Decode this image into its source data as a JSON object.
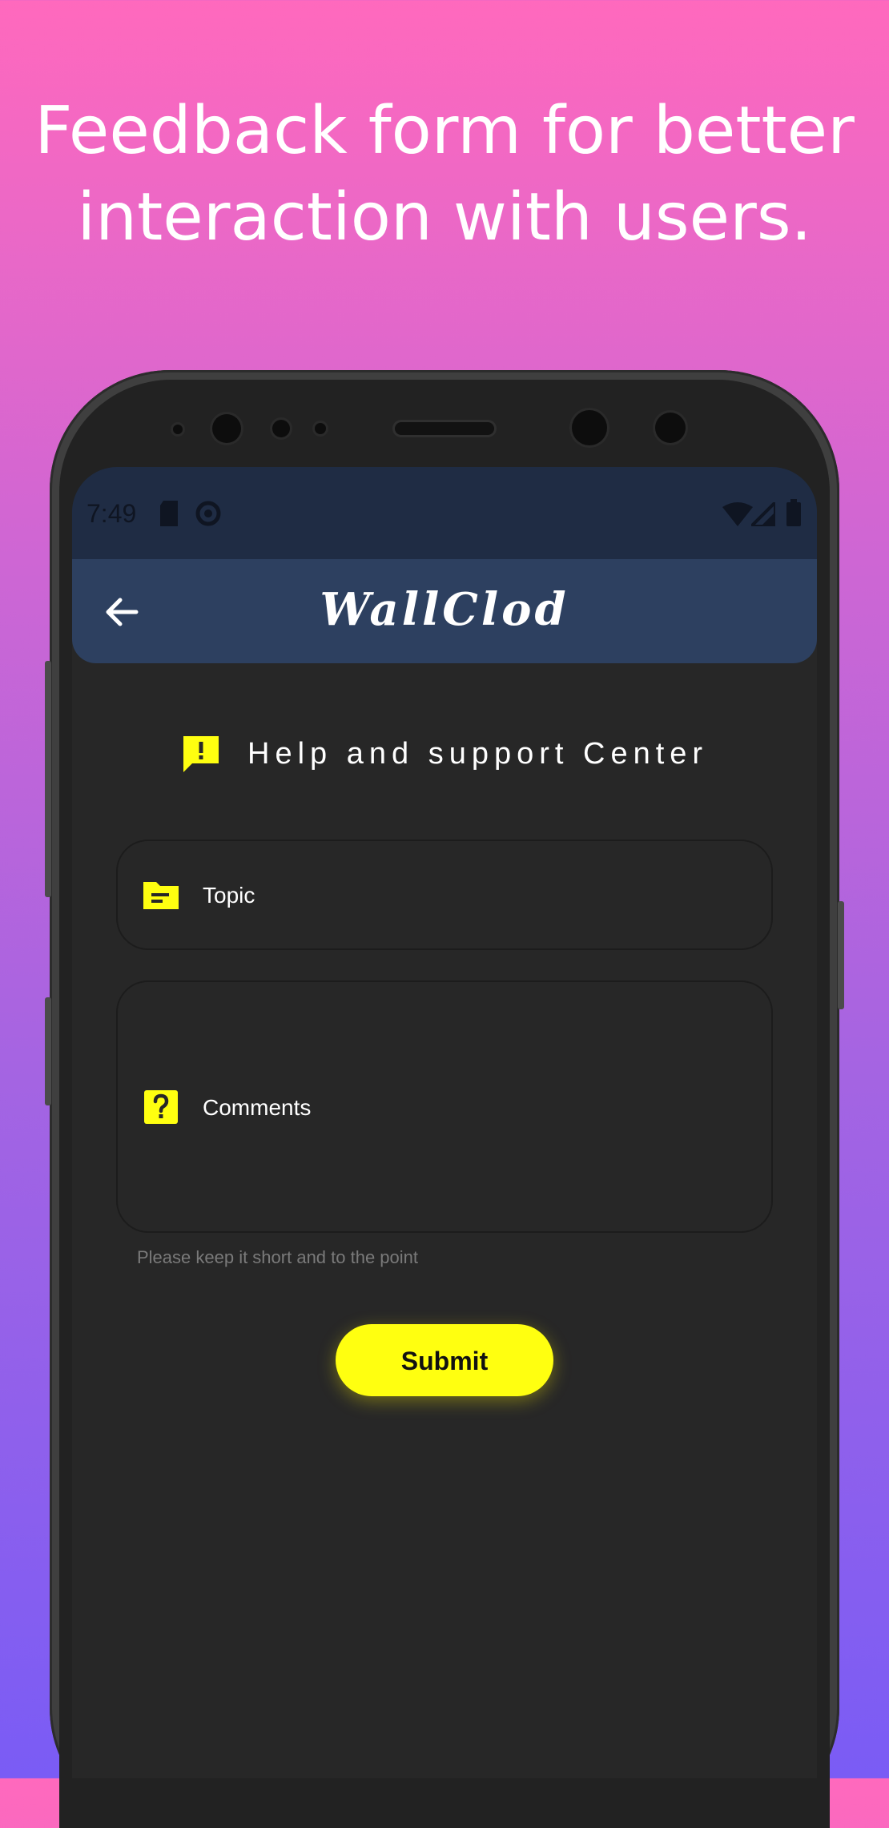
{
  "promo": {
    "headline_line1": "Feedback form for better",
    "headline_line2": "interaction with users."
  },
  "status_bar": {
    "time": "7:49",
    "left_icons": [
      "sd-card-icon",
      "sync-icon"
    ],
    "right_icons": [
      "wifi-icon",
      "signal-icon",
      "battery-icon"
    ]
  },
  "app_bar": {
    "title": "WallClod",
    "back_icon": "arrow-left-icon"
  },
  "help": {
    "title": "Help and support Center",
    "icon": "feedback-icon"
  },
  "form": {
    "topic_label": "Topic",
    "topic_icon": "folder-icon",
    "comments_label": "Comments",
    "comments_icon": "help-icon",
    "helper_text": "Please keep it short and to the point",
    "submit_label": "Submit"
  },
  "colors": {
    "accent": "#FFFF10",
    "app_bar": "#2D4060",
    "status_bar": "#1F2C44",
    "screen_bg": "#272727"
  }
}
